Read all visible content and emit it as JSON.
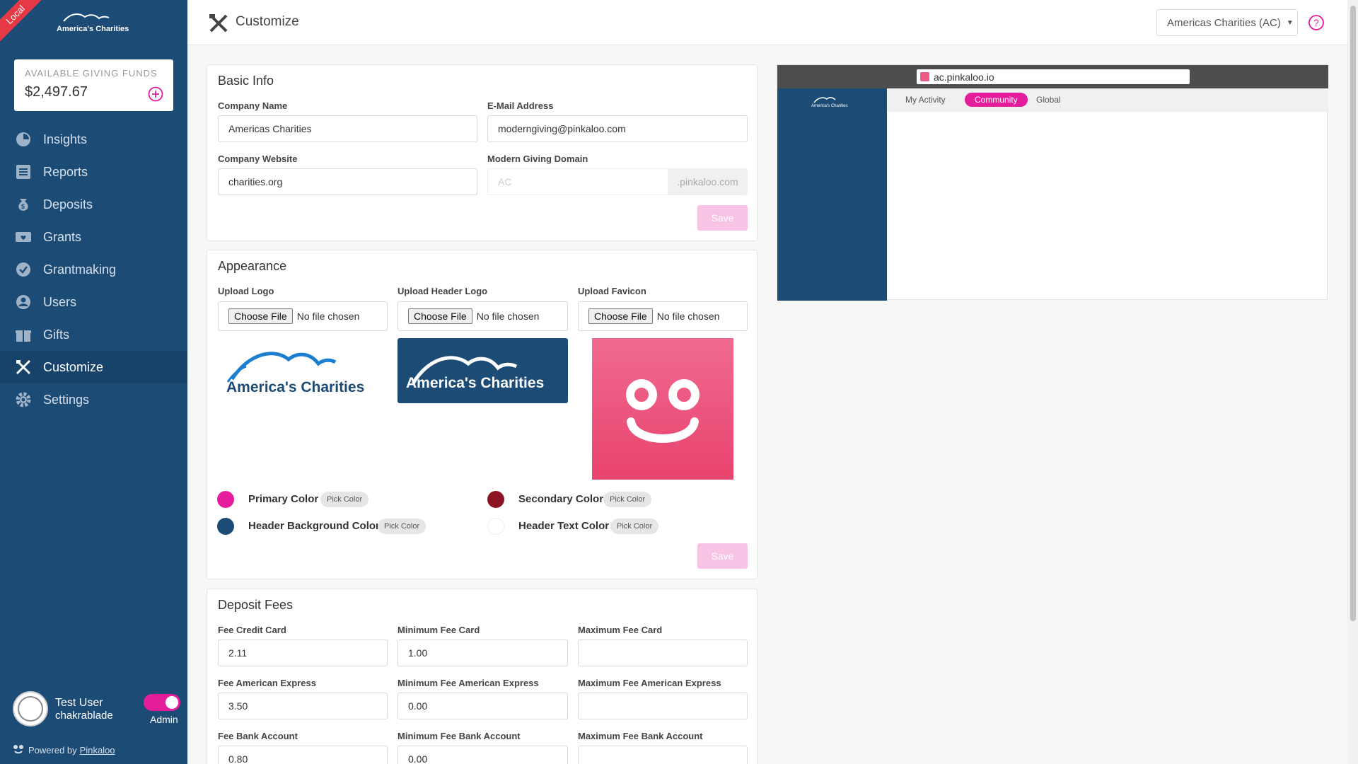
{
  "env_badge": "Local",
  "brand": {
    "name": "America's Charities"
  },
  "funds": {
    "label": "AVAILABLE GIVING FUNDS",
    "amount": "$2,497.67"
  },
  "nav": [
    {
      "label": "Insights",
      "icon": "pie-chart-icon"
    },
    {
      "label": "Reports",
      "icon": "list-icon"
    },
    {
      "label": "Deposits",
      "icon": "dollar-bag-icon"
    },
    {
      "label": "Grants",
      "icon": "heart-envelope-icon"
    },
    {
      "label": "Grantmaking",
      "icon": "check-badge-icon"
    },
    {
      "label": "Users",
      "icon": "user-circle-icon"
    },
    {
      "label": "Gifts",
      "icon": "gift-icon"
    },
    {
      "label": "Customize",
      "icon": "tools-icon",
      "active": true
    },
    {
      "label": "Settings",
      "icon": "gear-icon"
    }
  ],
  "user": {
    "name": "Test User",
    "handle": "chakrablade",
    "role": "Admin"
  },
  "powered": {
    "prefix": "Powered by",
    "link": "Pinkaloo"
  },
  "topbar": {
    "title": "Customize",
    "org": "Americas Charities (AC)"
  },
  "basic": {
    "title": "Basic Info",
    "company_name_label": "Company Name",
    "company_name": "Americas Charities",
    "email_label": "E-Mail Address",
    "email": "moderngiving@pinkaloo.com",
    "website_label": "Company Website",
    "website": "charities.org",
    "domain_label": "Modern Giving Domain",
    "domain": "AC",
    "domain_suffix": ".pinkaloo.com",
    "save": "Save"
  },
  "appearance": {
    "title": "Appearance",
    "upload_logo": "Upload Logo",
    "upload_header_logo": "Upload Header Logo",
    "upload_favicon": "Upload Favicon",
    "choose_file": "Choose File",
    "no_file": "No file chosen",
    "colors": [
      {
        "label": "Primary Color",
        "hex": "#e51d9d"
      },
      {
        "label": "Secondary Color",
        "hex": "#8c1321"
      },
      {
        "label": "Header Background Color",
        "hex": "#1c4b76"
      },
      {
        "label": "Header Text Color",
        "hex": "#ffffff"
      }
    ],
    "pick": "Pick Color",
    "save": "Save"
  },
  "fees": {
    "title": "Deposit Fees",
    "rows": [
      [
        {
          "label": "Fee Credit Card",
          "value": "2.11"
        },
        {
          "label": "Minimum Fee Card",
          "value": "1.00"
        },
        {
          "label": "Maximum Fee Card",
          "value": ""
        }
      ],
      [
        {
          "label": "Fee American Express",
          "value": "3.50"
        },
        {
          "label": "Minimum Fee American Express",
          "value": "0.00"
        },
        {
          "label": "Maximum Fee American Express",
          "value": ""
        }
      ],
      [
        {
          "label": "Fee Bank Account",
          "value": "0.80"
        },
        {
          "label": "Minimum Fee Bank Account",
          "value": "0.00"
        },
        {
          "label": "Maximum Fee Bank Account",
          "value": ""
        }
      ]
    ]
  },
  "preview": {
    "url": "ac.pinkaloo.io",
    "tabs": [
      "My Activity",
      "Community",
      "Global"
    ],
    "active_tab": "Community"
  },
  "colors": {
    "sidebar": "#1c4b76",
    "accent": "#e51d9d",
    "favicon_bg": "#ec5a86"
  }
}
